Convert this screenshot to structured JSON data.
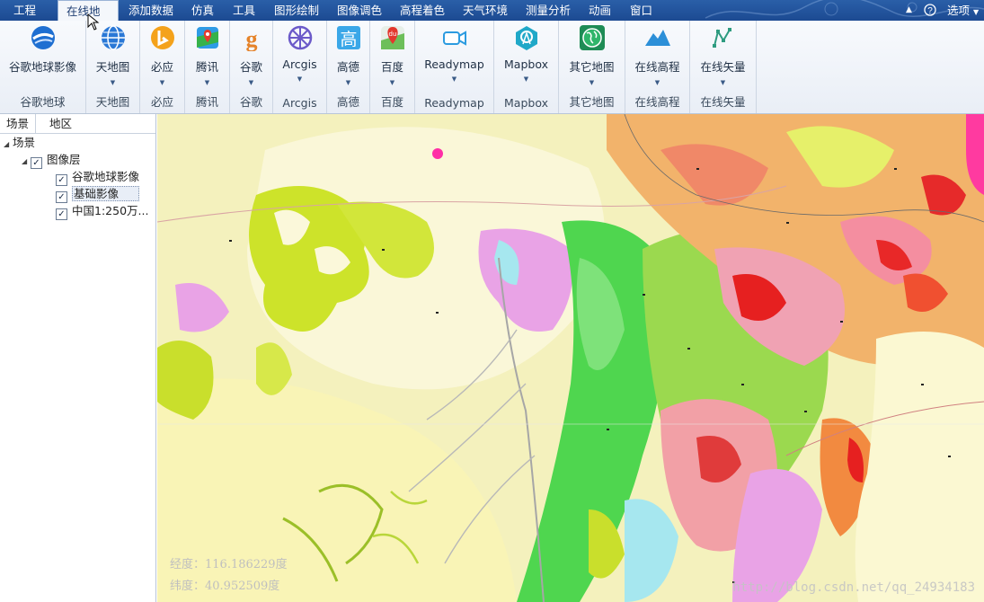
{
  "menu": {
    "items": [
      "工程",
      "在线地图",
      "添加数据",
      "仿真",
      "工具",
      "图形绘制",
      "图像调色",
      "高程着色",
      "天气环境",
      "测量分析",
      "动画",
      "窗口"
    ],
    "active_index": 1,
    "help_icon": "question-icon",
    "options_label": "选项"
  },
  "ribbon": {
    "groups": [
      {
        "label": "谷歌地球影像",
        "group": "谷歌地球",
        "icon": "google-earth-icon",
        "has_dropdown": false
      },
      {
        "label": "天地图",
        "group": "天地图",
        "icon": "globe-icon",
        "has_dropdown": true
      },
      {
        "label": "必应",
        "group": "必应",
        "icon": "bing-icon",
        "has_dropdown": true
      },
      {
        "label": "腾讯",
        "group": "腾讯",
        "icon": "tencent-map-icon",
        "has_dropdown": true
      },
      {
        "label": "谷歌",
        "group": "谷歌",
        "icon": "google-icon",
        "has_dropdown": true
      },
      {
        "label": "Arcgis",
        "group": "Arcgis",
        "icon": "arcgis-icon",
        "has_dropdown": true
      },
      {
        "label": "高德",
        "group": "高德",
        "icon": "gaode-icon",
        "has_dropdown": true
      },
      {
        "label": "百度",
        "group": "百度",
        "icon": "baidu-icon",
        "has_dropdown": true
      },
      {
        "label": "Readymap",
        "group": "Readymap",
        "icon": "camera-icon",
        "has_dropdown": true
      },
      {
        "label": "Mapbox",
        "group": "Mapbox",
        "icon": "mapbox-icon",
        "has_dropdown": true
      },
      {
        "label": "其它地图",
        "group": "其它地图",
        "icon": "earth-icon",
        "has_dropdown": true
      },
      {
        "label": "在线高程",
        "group": "在线高程",
        "icon": "mountain-icon",
        "has_dropdown": true
      },
      {
        "label": "在线矢量",
        "group": "在线矢量",
        "icon": "vector-icon",
        "has_dropdown": true
      }
    ]
  },
  "panel": {
    "tabs": [
      "场景",
      "地区"
    ],
    "tree": {
      "root": "场景",
      "layer_group": "图像层",
      "layers": [
        "谷歌地球影像",
        "基础影像",
        "中国1:250万..."
      ]
    }
  },
  "map": {
    "coord_lon": "经度：116.186229度",
    "coord_lat": "纬度：40.952509度",
    "watermark": "http://blog.csdn.net/qq_24934183"
  },
  "colors": {
    "menubar": "#1c4a92",
    "map_base": "#f3f0b8"
  }
}
